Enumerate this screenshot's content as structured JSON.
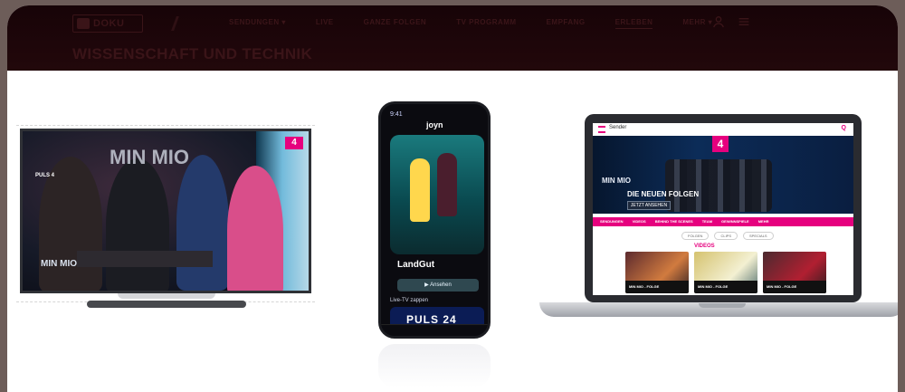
{
  "site": {
    "logo_text": "DOKU",
    "nav": [
      "SENDUNGEN ▾",
      "LIVE",
      "GANZE FOLGEN",
      "TV PROGRAMM",
      "EMPFANG",
      "ERLEBEN",
      "MEHR ▾"
    ],
    "active_nav_index": 5,
    "header_title": "WISSENSCHAFT UND TECHNIK"
  },
  "devices": {
    "tv": {
      "brand_label": "PULS 4",
      "show_logo": "MIN MIO",
      "show_logo_small": "MIN MIO",
      "channel_badge": "4"
    },
    "phone": {
      "status_time": "9:41",
      "app_brand": "joyn",
      "poster_title": "LandGut",
      "cta": "▶ Ansehen",
      "live_label": "Live-TV zappen",
      "live_tile": "PULS 24"
    },
    "laptop": {
      "header_menu": "Sender",
      "header_search": "Q",
      "hero_badge": "4",
      "hero_show": "MIN MIO",
      "hero_title": "DIE NEUEN FOLGEN",
      "hero_cta": "JETZT ANSEHEN",
      "tabs": [
        "SENDUNGEN",
        "VIDEOS",
        "BEHIND THE SCENES",
        "TEAM",
        "GEWINNSPIELE",
        "MEHR"
      ],
      "chips": [
        "FOLGEN",
        "CLIPS",
        "SPECIALS"
      ],
      "videos_heading": "VIDEOS",
      "cards": [
        "MIN MIO - FOLGE",
        "MIN MIO - FOLGE",
        "MIN MIO - FOLGE"
      ]
    }
  },
  "colors": {
    "accent": "#e6007e",
    "top_bg": "#1e060a",
    "page_bg": "#ffffff"
  }
}
